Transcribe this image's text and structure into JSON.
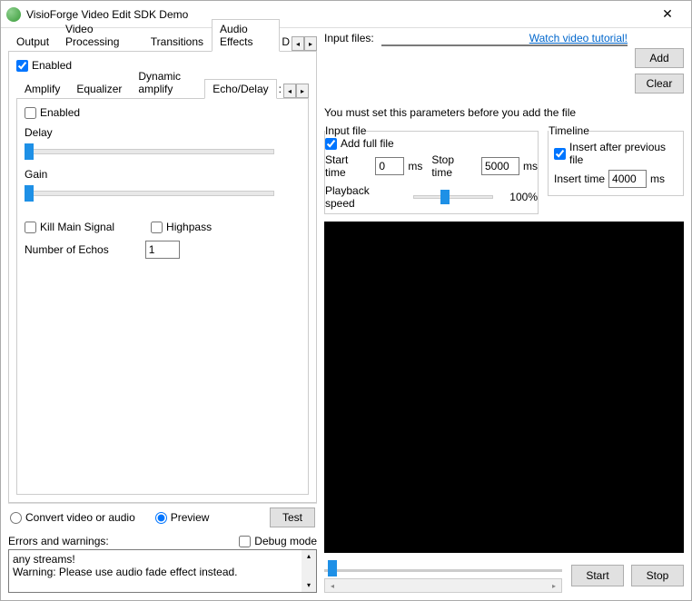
{
  "window": {
    "title": "VisioForge Video Edit SDK Demo"
  },
  "mainTabs": {
    "items": [
      "Output",
      "Video Processing",
      "Transitions",
      "Audio Effects"
    ],
    "active": 3,
    "partial": "D"
  },
  "audioEffects": {
    "enabled_label": "Enabled",
    "enabled": true,
    "subTabs": {
      "items": [
        "Amplify",
        "Equalizer",
        "Dynamic amplify",
        "Echo/Delay"
      ],
      "active": 3,
      "partial": ":"
    },
    "echo": {
      "enabled_label": "Enabled",
      "enabled": false,
      "delay_label": "Delay",
      "gain_label": "Gain",
      "kill_main_label": "Kill Main Signal",
      "kill_main": false,
      "highpass_label": "Highpass",
      "highpass": false,
      "num_echos_label": "Number of Echos",
      "num_echos": "1"
    }
  },
  "mode": {
    "convert_label": "Convert video or audio",
    "preview_label": "Preview",
    "selected": "preview",
    "test_label": "Test"
  },
  "errors": {
    "header": "Errors and warnings:",
    "debug_label": "Debug mode",
    "debug": false,
    "lines": [
      "any streams!",
      "Warning: Please use audio fade effect instead."
    ]
  },
  "inputFiles": {
    "label": "Input files:",
    "add_label": "Add",
    "clear_label": "Clear",
    "tutorial_link": "Watch video tutorial!"
  },
  "params": {
    "intro": "You must set this parameters before you add the file",
    "inputFile": {
      "legend": "Input file",
      "add_full_label": "Add full file",
      "add_full": true,
      "start_label": "Start time",
      "start_value": "0",
      "stop_label": "Stop time",
      "stop_value": "5000",
      "ms": "ms",
      "playback_label": "Playback speed",
      "playback_pct": "100%"
    },
    "timeline": {
      "legend": "Timeline",
      "insert_after_label": "Insert after previous file",
      "insert_after": true,
      "insert_time_label": "Insert time",
      "insert_time_value": "4000",
      "ms": "ms"
    }
  },
  "controls": {
    "start_label": "Start",
    "stop_label": "Stop"
  }
}
